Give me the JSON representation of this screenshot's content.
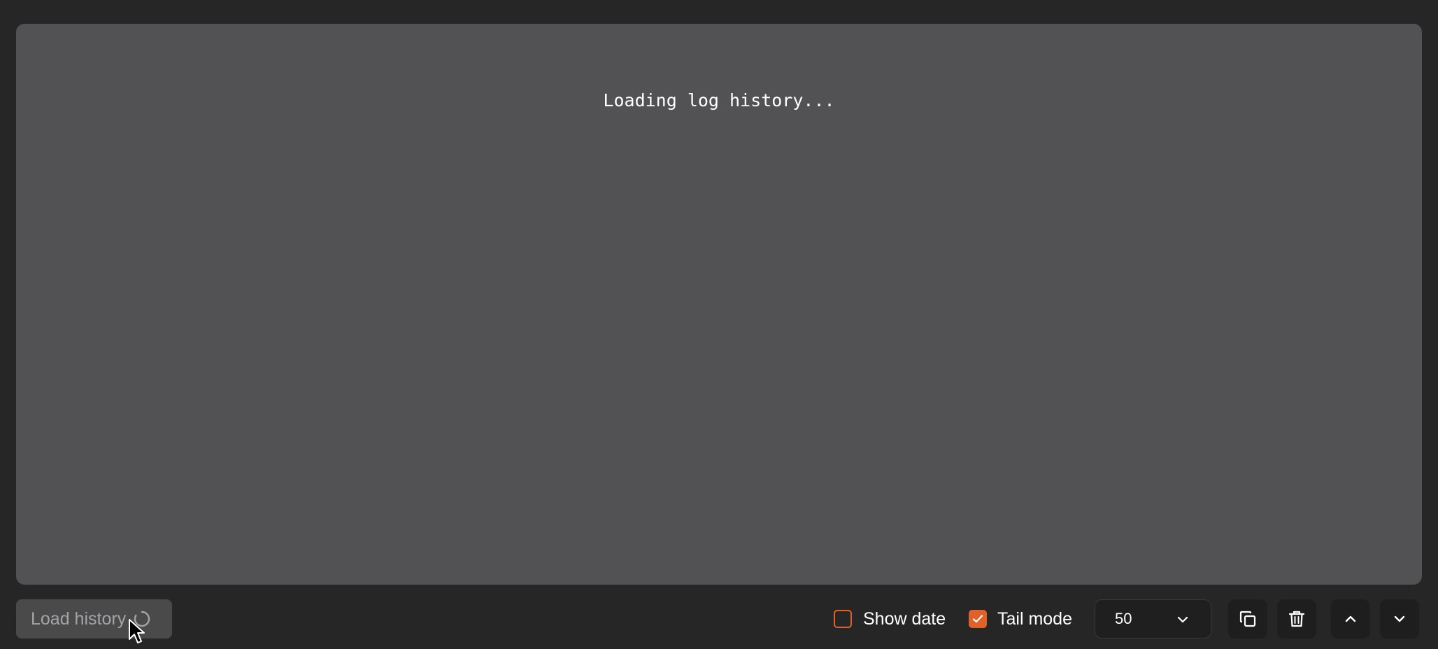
{
  "log": {
    "status_text": "Loading log history..."
  },
  "toolbar": {
    "load_history_label": "Load history",
    "show_date": {
      "label": "Show date",
      "checked": false
    },
    "tail_mode": {
      "label": "Tail mode",
      "checked": true
    },
    "lines_select": {
      "value": "50"
    }
  },
  "icons": {
    "load_spinner": "spinner-icon",
    "copy": "copy-icon",
    "delete": "trash-icon",
    "scroll_up": "chevron-up-icon",
    "scroll_down": "chevron-down-icon",
    "select_chevron": "chevron-down-icon",
    "checkmark": "check-icon",
    "cursor": "mouse-pointer-icon"
  },
  "colors": {
    "accent": "#e0622a",
    "background": "#262626",
    "panel": "#525254",
    "button_bg": "#1e1e1e"
  }
}
